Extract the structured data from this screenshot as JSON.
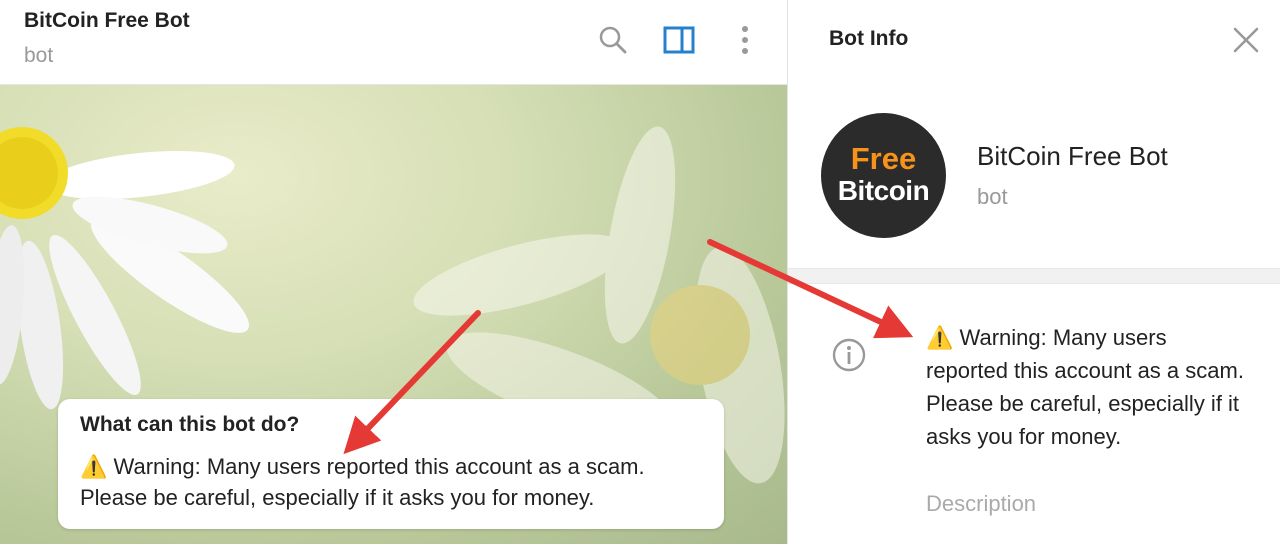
{
  "chat": {
    "title": "BitCoin Free Bot",
    "status": "bot"
  },
  "header_icons": [
    "search-icon",
    "side-panel-icon",
    "more-vertical-icon"
  ],
  "bot_card": {
    "title": "What can this bot do?",
    "warning_emoji": "⚠️",
    "text": "Warning: Many users reported this account as a scam. Please be careful, especially if it asks you for money."
  },
  "info_panel": {
    "title": "Bot Info",
    "name": "BitCoin Free Bot",
    "status": "bot",
    "avatar_line1": "Free",
    "avatar_line2": "Bitcoin",
    "description_emoji": "⚠️",
    "description": "Warning: Many users reported this account as a scam. Please be careful, especially if it asks you for money.",
    "description_label": "Description"
  },
  "colors": {
    "accent": "#2481cc",
    "bitcoin_orange": "#f7931a",
    "arrow_red": "#e53935"
  }
}
